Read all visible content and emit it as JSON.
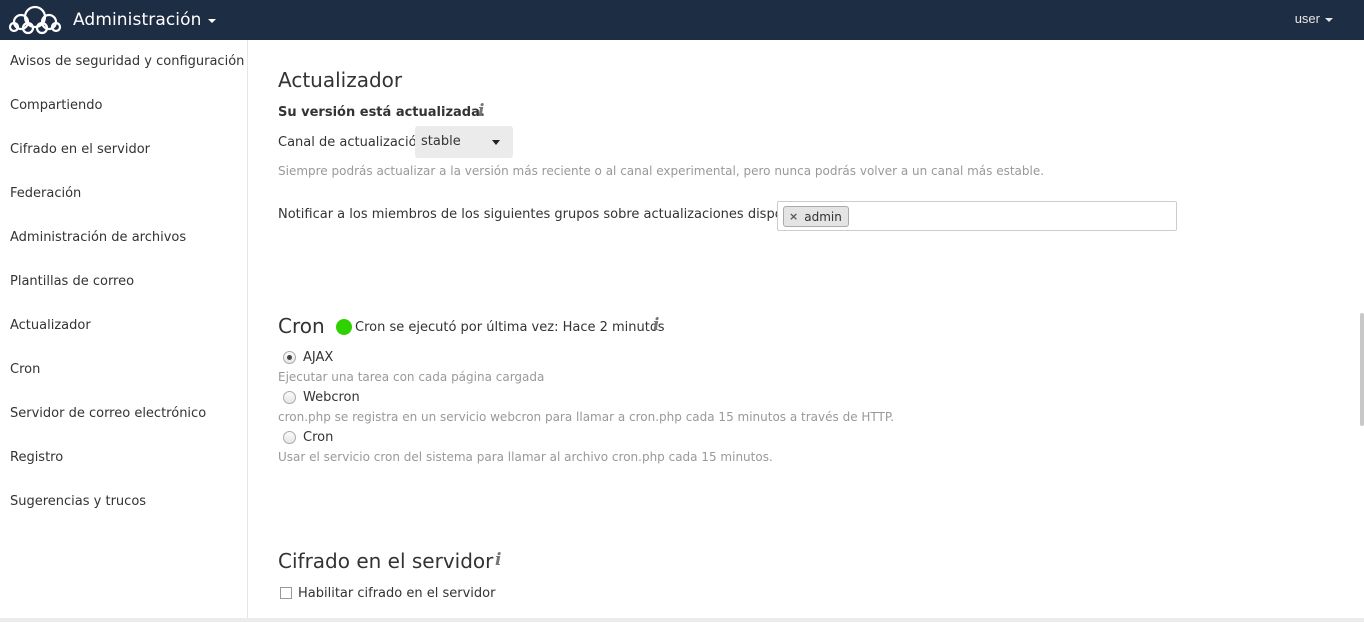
{
  "header": {
    "logo_icon": "owncloud-cloud-logo-icon",
    "app_title": "Administración",
    "user_label": "user",
    "bg_color": "#1d2d44"
  },
  "sidebar": {
    "items": [
      {
        "label": "Avisos de seguridad y configuración"
      },
      {
        "label": "Compartiendo"
      },
      {
        "label": "Cifrado en el servidor"
      },
      {
        "label": "Federación"
      },
      {
        "label": "Administración de archivos"
      },
      {
        "label": "Plantillas de correo"
      },
      {
        "label": "Actualizador"
      },
      {
        "label": "Cron"
      },
      {
        "label": "Servidor de correo electrónico"
      },
      {
        "label": "Registro"
      },
      {
        "label": "Sugerencias y trucos"
      }
    ]
  },
  "updater": {
    "title": "Actualizador",
    "status": "Su versión está actualizada.",
    "info_icon": "i",
    "channel_label": "Canal de actualización:",
    "channel_value": "stable",
    "channel_hint": "Siempre podrás actualizar a la versión más reciente o al canal experimental, pero nunca podrás volver a un canal más estable.",
    "notify_label": "Notificar a los miembros de los siguientes grupos sobre actualizaciones disponibles:",
    "notify_groups": [
      "admin"
    ],
    "tag_remove": "×"
  },
  "cron": {
    "title": "Cron",
    "status_text": "Cron se ejecutó por última vez: Hace 2 minutos",
    "status_color": "#2fd100",
    "info_icon": "i",
    "options": [
      {
        "label": "AJAX",
        "hint": "Ejecutar una tarea con cada página cargada",
        "checked": true
      },
      {
        "label": "Webcron",
        "hint": "cron.php se registra en un servicio webcron para llamar a cron.php cada 15 minutos a través de HTTP.",
        "checked": false
      },
      {
        "label": "Cron",
        "hint": "Usar el servicio cron del sistema para llamar al archivo cron.php cada 15 minutos.",
        "checked": false
      }
    ]
  },
  "encryption": {
    "title": "Cifrado en el servidor",
    "info_icon": "i",
    "enable_label": "Habilitar cifrado en el servidor",
    "enabled": false
  }
}
